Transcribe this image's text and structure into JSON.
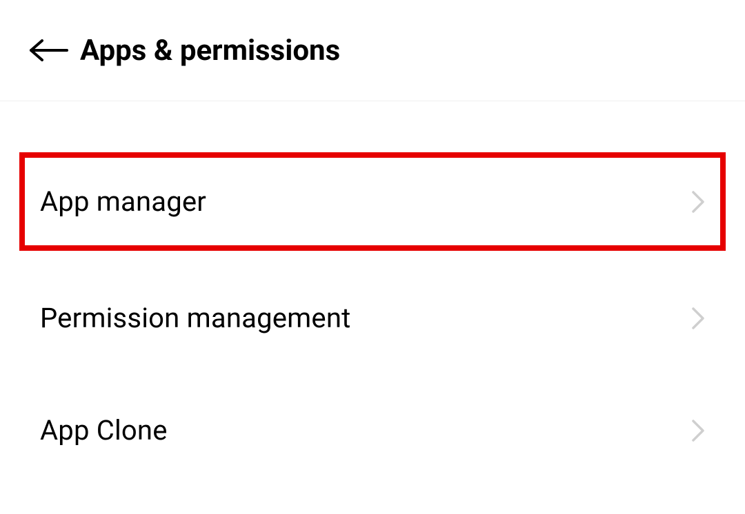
{
  "header": {
    "title": "Apps & permissions"
  },
  "list": {
    "items": [
      {
        "label": "App manager",
        "highlighted": true
      },
      {
        "label": "Permission management",
        "highlighted": false
      },
      {
        "label": "App Clone",
        "highlighted": false
      }
    ]
  }
}
